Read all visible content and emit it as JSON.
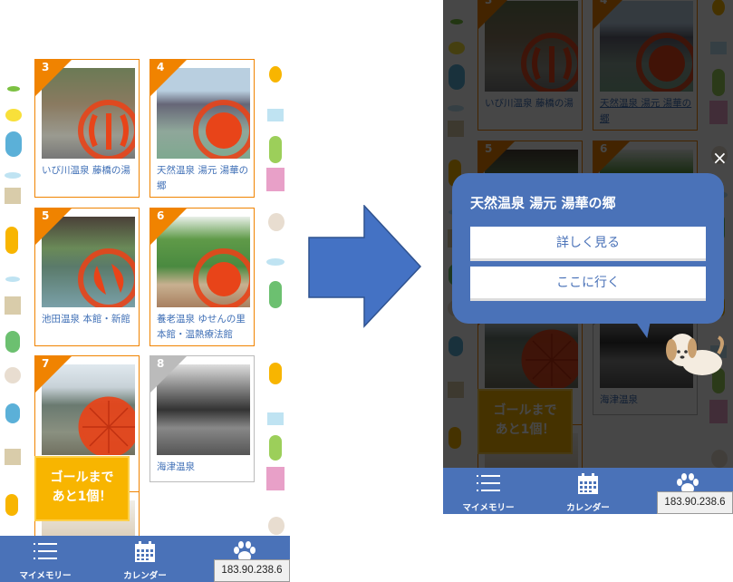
{
  "cards": [
    {
      "number": "3",
      "title": "いび川温泉 藤橋の湯",
      "collected": true
    },
    {
      "number": "4",
      "title": "天然温泉 湯元 湯華の郷",
      "collected": true
    },
    {
      "number": "5",
      "title": "池田温泉 本館・新館",
      "collected": true
    },
    {
      "number": "6",
      "title": "養老温泉 ゆせんの里本館・温熱療法館",
      "collected": true
    },
    {
      "number": "7",
      "title": "",
      "collected": true
    },
    {
      "number": "8",
      "title": "海津温泉",
      "collected": false
    }
  ],
  "goal_badge": {
    "line1": "ゴールまで",
    "line2": "あと1個！"
  },
  "nav": {
    "my_memory": "マイメモリー",
    "calendar": "カレンダー",
    "ip_address": "183.90.238.6"
  },
  "popup": {
    "title": "天然温泉 湯元 湯華の郷",
    "details_button": "詳しく見る",
    "go_button": "ここに行く",
    "close_icon": "×"
  },
  "colors": {
    "accent": "#f08300",
    "nav": "#4a72b8",
    "goal": "#f8b500",
    "crest": "#e84419"
  }
}
